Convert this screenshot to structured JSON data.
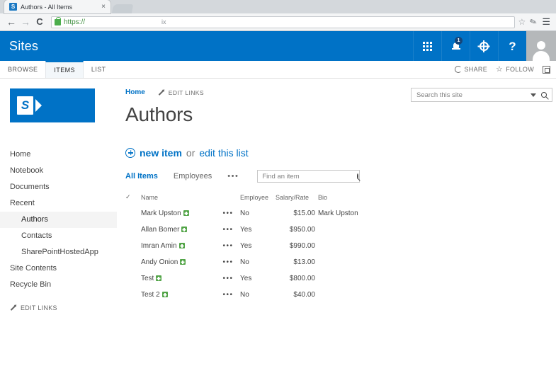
{
  "browser": {
    "tab_title": "Authors - All Items",
    "favicon_letter": "S",
    "close_label": "×",
    "back_icon": "←",
    "forward_icon": "→",
    "reload_icon": "C",
    "url_scheme": "https://",
    "url_rest": "",
    "omnibox_hint": "ix",
    "star_icon": "☆",
    "ext_icon": "✎",
    "menu_icon": "☰"
  },
  "suitebar": {
    "brand": "Sites",
    "notification_count": "1",
    "help_label": "?"
  },
  "ribbon": {
    "tabs": [
      {
        "label": "BROWSE",
        "selected": false
      },
      {
        "label": "ITEMS",
        "selected": true
      },
      {
        "label": "LIST",
        "selected": false
      }
    ],
    "share_label": "SHARE",
    "follow_label": "FOLLOW",
    "follow_icon": "☆"
  },
  "sidebar": {
    "logo_letter": "S",
    "items": [
      {
        "label": "Home",
        "child": false,
        "selected": false
      },
      {
        "label": "Notebook",
        "child": false,
        "selected": false
      },
      {
        "label": "Documents",
        "child": false,
        "selected": false
      },
      {
        "label": "Recent",
        "child": false,
        "selected": false
      },
      {
        "label": "Authors",
        "child": true,
        "selected": true
      },
      {
        "label": "Contacts",
        "child": true,
        "selected": false
      },
      {
        "label": "SharePointHostedApp",
        "child": true,
        "selected": false
      },
      {
        "label": "Site Contents",
        "child": false,
        "selected": false
      },
      {
        "label": "Recycle Bin",
        "child": false,
        "selected": false
      }
    ],
    "edit_links_label": "EDIT LINKS"
  },
  "content": {
    "topnav_home": "Home",
    "topnav_edit_links": "EDIT LINKS",
    "page_title": "Authors",
    "site_search_placeholder": "Search this site",
    "site_search_value": "",
    "new_item_label": "new item",
    "or_label": "or",
    "edit_list_label": "edit this list",
    "views": [
      {
        "label": "All Items",
        "selected": true
      },
      {
        "label": "Employees",
        "selected": false
      }
    ],
    "view_ellipsis": "•••",
    "find_placeholder": "Find an item",
    "find_value": ""
  },
  "list": {
    "check_header": "✓",
    "columns": [
      "Name",
      "Employee",
      "Salary/Rate",
      "Bio"
    ],
    "row_menu_icon": "•••",
    "rows": [
      {
        "name": "Mark Upston",
        "new": true,
        "employee": "No",
        "salary": "$15.00",
        "bio": "Mark Upston"
      },
      {
        "name": "Allan Bomer",
        "new": true,
        "employee": "Yes",
        "salary": "$950.00",
        "bio": ""
      },
      {
        "name": "Imran Amin",
        "new": true,
        "employee": "Yes",
        "salary": "$990.00",
        "bio": ""
      },
      {
        "name": "Andy Onion",
        "new": true,
        "employee": "No",
        "salary": "$13.00",
        "bio": ""
      },
      {
        "name": "Test",
        "new": true,
        "employee": "Yes",
        "salary": "$800.00",
        "bio": ""
      },
      {
        "name": "Test 2",
        "new": true,
        "employee": "No",
        "salary": "$40.00",
        "bio": ""
      }
    ]
  },
  "colors": {
    "sharepoint_blue": "#0072c6",
    "link_blue": "#0072c6",
    "new_badge_green": "#52a447"
  }
}
